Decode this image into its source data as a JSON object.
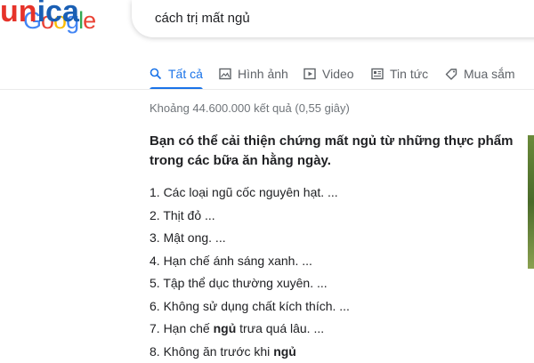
{
  "logo": {
    "google_text": "Google",
    "google_colors": [
      "#4285F4",
      "#EA4335",
      "#FBBC05",
      "#4285F4",
      "#34A853",
      "#EA4335"
    ],
    "watermark_text": "unica",
    "watermark_colors": [
      "#e6332a",
      "#e6332a",
      "#1a5fb4",
      "#1a5fb4",
      "#1a5fb4"
    ]
  },
  "search": {
    "query": "cách trị mất ngủ"
  },
  "tabs": [
    {
      "label": "Tất cả",
      "icon": "search-icon",
      "active": true
    },
    {
      "label": "Hình ảnh",
      "icon": "image-icon",
      "active": false
    },
    {
      "label": "Video",
      "icon": "video-icon",
      "active": false
    },
    {
      "label": "Tin tức",
      "icon": "news-icon",
      "active": false
    },
    {
      "label": "Mua sắm",
      "icon": "tag-icon",
      "active": false
    }
  ],
  "results": {
    "stats": "Khoảng 44.600.000 kết quả (0,55 giây)"
  },
  "snippet": {
    "heading": "Bạn có thể cải thiện chứng mất ngủ từ những thực phẩm trong các bữa ăn hằng ngày.",
    "items": [
      {
        "text": "1. Các loại ngũ cốc nguyên hạt. ..."
      },
      {
        "text": "2. Thịt đỏ ..."
      },
      {
        "text": "3. Mật ong. ..."
      },
      {
        "text": "4. Hạn chế ánh sáng xanh. ..."
      },
      {
        "text": "5. Tập thể dục thường xuyên. ..."
      },
      {
        "text": "6. Không sử dụng chất kích thích. ..."
      },
      {
        "pre": "7. Hạn chế ",
        "bold": "ngủ",
        "post": " trưa quá lâu. ..."
      },
      {
        "pre": "8. Không ăn trước khi ",
        "bold": "ngủ",
        "post": ""
      }
    ]
  },
  "colors": {
    "accent": "#1a73e8",
    "muted": "#70757a",
    "tab_text": "#5f6368"
  }
}
